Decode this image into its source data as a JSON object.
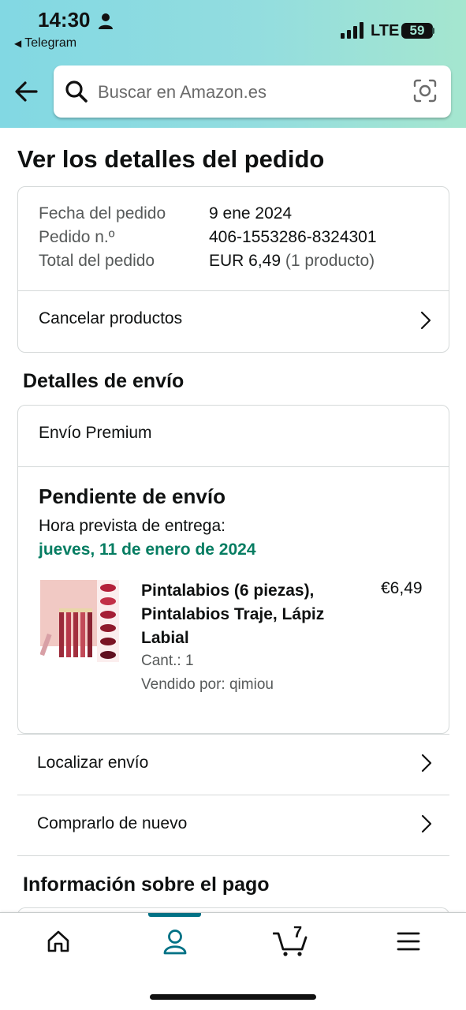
{
  "status_bar": {
    "time": "14:30",
    "back_app": "Telegram",
    "network": "LTE",
    "battery": "59"
  },
  "search": {
    "placeholder": "Buscar en Amazon.es"
  },
  "page": {
    "title": "Ver los detalles del pedido"
  },
  "order_summary": {
    "rows": [
      {
        "label": "Fecha del pedido",
        "value": "9 ene 2024"
      },
      {
        "label": "Pedido n.º",
        "value": "406-1553286-8324301"
      },
      {
        "label": "Total del pedido",
        "value": "EUR 6,49",
        "extra": "(1 producto)"
      }
    ],
    "cancel_label": "Cancelar productos"
  },
  "shipping": {
    "section_title": "Detalles de envío",
    "method": "Envío Premium",
    "status": "Pendiente de envío",
    "eta_label": "Hora prevista de entrega:",
    "eta_date": "jueves, 11 de enero de 2024",
    "product": {
      "name": "Pintalabios (6 piezas), Pintalabios Traje, Lápiz Labial",
      "price": "€6,49",
      "quantity": "Cant.: 1",
      "seller": "Vendido por: qimiou"
    }
  },
  "actions": {
    "track": "Localizar envío",
    "buy_again": "Comprarlo de nuevo"
  },
  "payment": {
    "section_title": "Información sobre el pago"
  },
  "tabbar": {
    "items": [
      {
        "name": "home",
        "icon": "home-icon"
      },
      {
        "name": "account",
        "icon": "person-icon",
        "active": true
      },
      {
        "name": "cart",
        "icon": "cart-icon",
        "count": "7"
      },
      {
        "name": "menu",
        "icon": "menu-icon"
      }
    ]
  },
  "colors": {
    "accent": "#007185",
    "delivery_green": "#067d62",
    "header_gradient_start": "#82d8e3",
    "header_gradient_end": "#a5e6cf"
  }
}
